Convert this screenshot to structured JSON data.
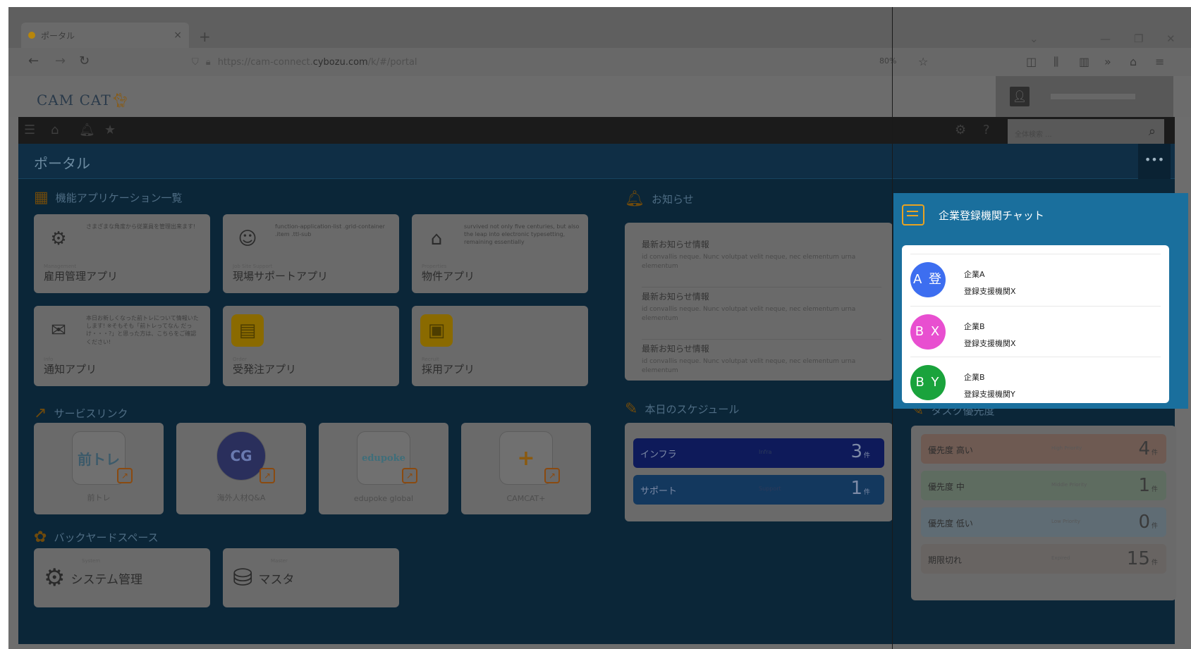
{
  "browser": {
    "tab_title": "ポータル",
    "tab_close": "×",
    "new_tab": "+",
    "url_prefix": "https://cam-connect.",
    "url_host": "cybozu.com",
    "url_path": "/k/#/portal",
    "zoom": "80%",
    "window_controls": [
      "⌄",
      "—",
      "❐",
      "✕"
    ]
  },
  "app": {
    "logo_text": "CAM CAT",
    "logo_icon": "cat-icon",
    "search_placeholder": "全体検索 ..."
  },
  "portal": {
    "title": "ポータル",
    "more_label": "•••"
  },
  "sections": {
    "apps_title": "機能アプリケーション一覧",
    "links_title": "サービスリンク",
    "backyard_title": "バックヤードスペース",
    "news_title": "お知らせ",
    "schedule_title": "本日のスケジュール",
    "task_title": "タスク優先度"
  },
  "apps": [
    {
      "title": "雇用管理アプリ",
      "sub": "Management",
      "desc": "さまざまな角度から従業員を管理出来ます!",
      "icon": "employees-icon"
    },
    {
      "title": "現場サポートアプリ",
      "sub": "Job Site Support",
      "desc": "function-application-list .grid-container .item .ttl-sub",
      "icon": "support-icon"
    },
    {
      "title": "物件アプリ",
      "sub": "Properties",
      "desc": "survived not only five centuries, but also the leap into electronic typesetting, remaining essentially",
      "icon": "house-icon"
    },
    {
      "title": "通知アプリ",
      "sub": "Info",
      "desc": "本日お新しくなった前トレについて情報いたします! ※そもそも「前トレってなん だっけ・・・?」と思った方は、こちらをご確認ください!",
      "icon": "mail-icon"
    },
    {
      "title": "受発注アプリ",
      "sub": "Order",
      "desc": "",
      "icon": "clipboard-icon"
    },
    {
      "title": "採用アプリ",
      "sub": "Recruit",
      "desc": "",
      "icon": "id-card-icon"
    }
  ],
  "links": [
    {
      "label": "前トレ",
      "badge": "前トレ"
    },
    {
      "label": "海外人材Q&A",
      "badge": "CG"
    },
    {
      "label": "edupoke global",
      "badge": "edupoke"
    },
    {
      "label": "CAMCAT+",
      "badge": "+"
    }
  ],
  "backyard": [
    {
      "title": "システム管理",
      "sub": "System",
      "icon": "gear-icon"
    },
    {
      "title": "マスタ",
      "sub": "Master",
      "icon": "database-icon"
    }
  ],
  "news": [
    {
      "heading": "最新お知らせ情報",
      "body": "id convallis neque. Nunc volutpat velit neque, nec elementum urna elementum"
    },
    {
      "heading": "最新お知らせ情報",
      "body": "id convallis neque. Nunc volutpat velit neque, nec elementum urna elementum"
    },
    {
      "heading": "最新お知らせ情報",
      "body": "id convallis neque. Nunc volutpat velit neque, nec elementum urna elementum"
    }
  ],
  "schedule": [
    {
      "label": "インフラ",
      "mid": "Infra",
      "count": "3",
      "unit": "件",
      "color": "#0e1a5a"
    },
    {
      "label": "サポート",
      "mid": "Support",
      "count": "1",
      "unit": "件",
      "color": "#13385e"
    }
  ],
  "tasks": [
    {
      "label": "優先度 高い",
      "mid": "High Priority",
      "count": "4",
      "unit": "件",
      "color": "#6e5a52"
    },
    {
      "label": "優先度 中",
      "mid": "Middle Priority",
      "count": "1",
      "unit": "件",
      "color": "#5e6c60"
    },
    {
      "label": "優先度 低い",
      "mid": "Low Priority",
      "count": "0",
      "unit": "件",
      "color": "#5f6c74"
    },
    {
      "label": "期限切れ",
      "mid": "Expired",
      "count": "15",
      "unit": "件",
      "color": "#686462"
    }
  ],
  "chat": {
    "title": "企業登録機関チャット",
    "items": [
      {
        "avatar": "A 登",
        "name": "企業A",
        "org": "登録支援機関X",
        "color": "#3d6ef0"
      },
      {
        "avatar": "B X",
        "name": "企業B",
        "org": "登録支援機関X",
        "color": "#e84fd0"
      },
      {
        "avatar": "B Y",
        "name": "企業B",
        "org": "登録支援機関Y",
        "color": "#1aa33c"
      }
    ]
  }
}
